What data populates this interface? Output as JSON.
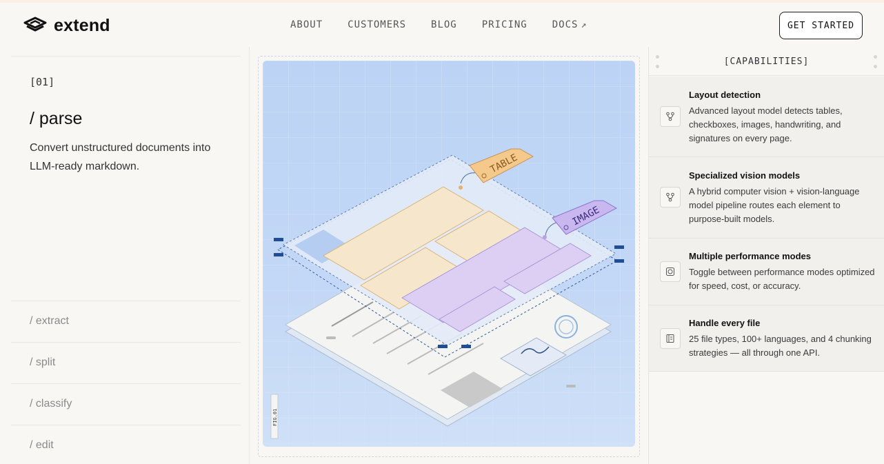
{
  "header": {
    "brand": "extend",
    "nav": [
      {
        "label": "ABOUT"
      },
      {
        "label": "CUSTOMERS"
      },
      {
        "label": "BLOG"
      },
      {
        "label": "PRICING"
      },
      {
        "label": "DOCS",
        "external_icon": "arrow-up-right-icon"
      }
    ],
    "cta_label": "GET STARTED"
  },
  "steps": {
    "active": {
      "number": "[01]",
      "title": "/ parse",
      "description": "Convert unstructured documents into LLM-ready markdown."
    },
    "others": [
      {
        "label": "/ extract"
      },
      {
        "label": "/ split"
      },
      {
        "label": "/ classify"
      },
      {
        "label": "/ edit"
      }
    ]
  },
  "figure": {
    "tag_table": "TABLE",
    "tag_image": "IMAGE",
    "fig_label": "FIG.01"
  },
  "capabilities": {
    "heading": "[CAPABILITIES]",
    "items": [
      {
        "title": "Layout detection",
        "description": "Advanced layout model detects tables, checkboxes, images, handwriting, and signatures on every page.",
        "icon": "branch-icon"
      },
      {
        "title": "Specialized vision models",
        "description": "A hybrid computer vision + vision-language model pipeline routes each element to purpose-built models.",
        "icon": "branch-icon"
      },
      {
        "title": "Multiple performance modes",
        "description": "Toggle between performance modes optimized for speed, cost, or accuracy.",
        "icon": "target-icon"
      },
      {
        "title": "Handle every file",
        "description": "25 file types, 100+ languages, and 4 chunking strategies — all through one API.",
        "icon": "file-icon"
      }
    ]
  }
}
